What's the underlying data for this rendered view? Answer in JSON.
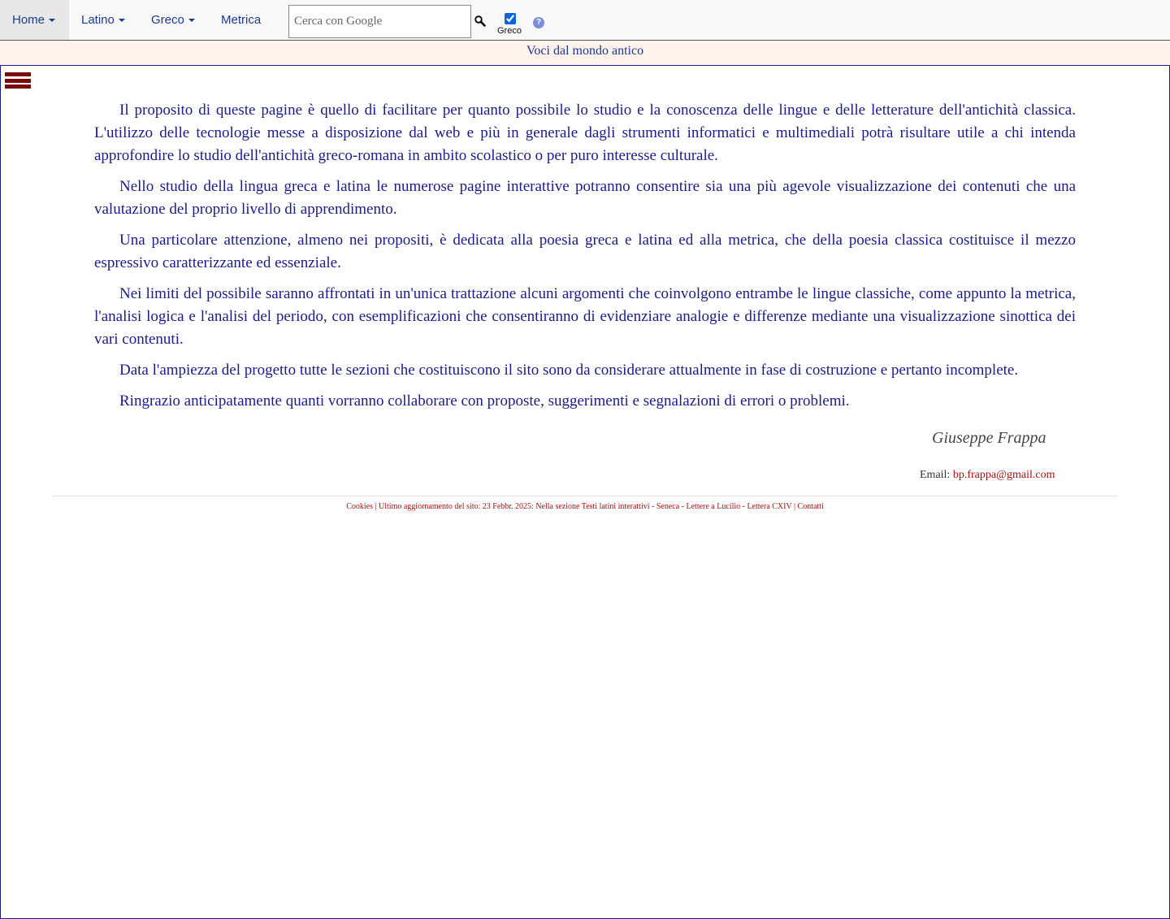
{
  "nav": {
    "items": [
      {
        "label": "Home",
        "dropdown": true,
        "active": true
      },
      {
        "label": "Latino",
        "dropdown": true
      },
      {
        "label": "Greco",
        "dropdown": true
      },
      {
        "label": "Metrica",
        "dropdown": false
      }
    ],
    "search_placeholder": "Cerca con Google",
    "greco_checkbox_label": "Greco",
    "greco_checked": true,
    "help_icon": "help-icon",
    "search_icon": "magnifier-icon"
  },
  "subtitle": "Voci dal mondo antico",
  "content": {
    "paragraphs": [
      "Il proposito di queste pagine è quello di facilitare per quanto possibile lo studio e la conoscenza delle lingue e delle letterature dell'antichità classica. L'utilizzo delle tecnologie messe a disposizione dal web e più in generale dagli strumenti informatici e multimediali potrà risultare utile a chi intenda approfondire lo studio dell'antichità greco-romana in ambito scolastico o per puro interesse culturale.",
      "Nello studio della lingua greca e latina le numerose pagine interattive potranno consentire sia una più agevole visualizzazione dei contenuti che una valutazione del proprio livello di apprendimento.",
      "Una particolare attenzione, almeno nei propositi, è dedicata alla poesia greca e latina ed alla metrica, che della poesia classica costituisce il mezzo espressivo caratterizzante ed essenziale.",
      "Nei limiti del possibile saranno affrontati in un'unica trattazione alcuni argomenti che coinvolgono entrambe le lingue classiche, come appunto la metrica, l'analisi logica e l'analisi del periodo, con esemplificazioni che consentiranno di evidenziare analogie e differenze mediante una visualizzazione sinottica dei vari contenuti.",
      "Data l'ampiezza del progetto tutte le sezioni che costituiscono il sito sono da considerare attualmente in fase di costruzione e pertanto incomplete.",
      "Ringrazio anticipatamente quanti vorranno collaborare con proposte, suggerimenti e segnalazioni di errori o problemi."
    ],
    "signature": "Giuseppe Frappa",
    "email_label": "Email: ",
    "email": "bp.frappa@gmail.com"
  },
  "footer": {
    "cookies": "Cookies",
    "sep1": " | ",
    "update_text": "Ultimo aggiornamento del sito: 23 Febbr. 2025: Nella sezione Testi latini interattivi - Seneca - Lettere a Lucilio - Lettera CXIV",
    "sep2": " | ",
    "contacts": "Contatti"
  },
  "colors": {
    "nav_text": "#1a3a8c",
    "body_text": "#1b1b8a",
    "accent_red": "#a01010",
    "menu_icon": "#7a0a0a"
  }
}
